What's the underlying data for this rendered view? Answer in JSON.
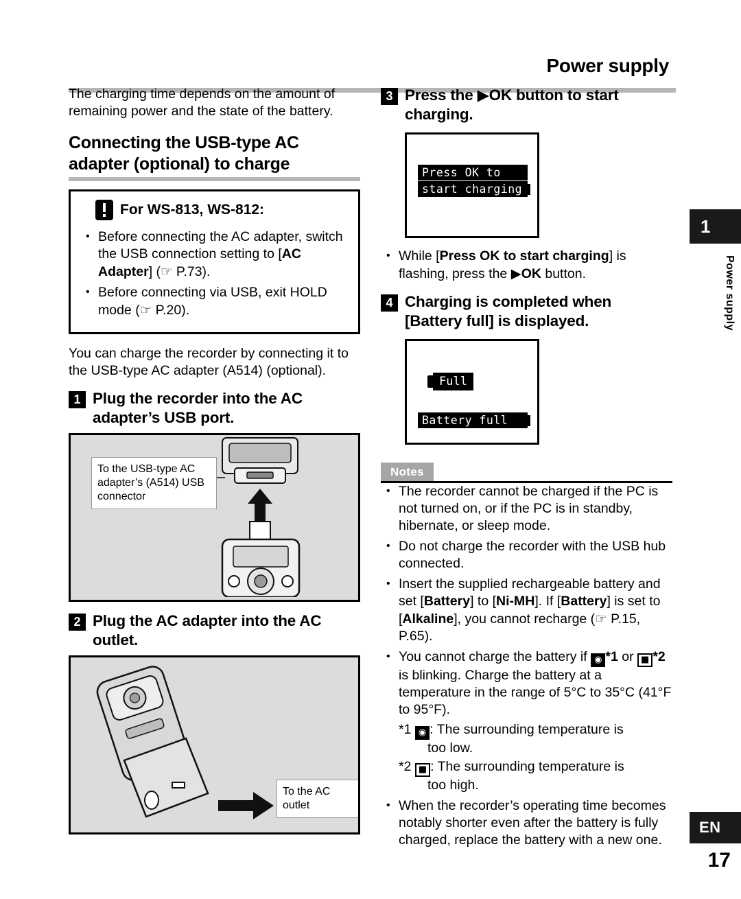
{
  "header": {
    "title": "Power supply"
  },
  "sidetab": {
    "chapter_number": "1",
    "chapter_label": "Power supply",
    "language": "EN",
    "page_number": "17"
  },
  "left": {
    "intro": "The charging time depends on the amount of remaining power and the state of the battery.",
    "section_heading": "Connecting the USB-type AC adapter (optional) to charge",
    "note_box": {
      "icon": "exclamation-icon",
      "title": "For WS-813, WS-812:",
      "bullets": [
        "Before connecting the AC adapter, switch the USB connection setting to [AC Adapter] (☞ P.73).",
        "Before connecting via USB, exit HOLD mode (☞ P.20)."
      ]
    },
    "paragraph": "You can charge the recorder by connecting it to the USB-type AC adapter (A514) (optional).",
    "step1": {
      "num": "1",
      "text": "Plug the recorder into the AC adapter’s USB port."
    },
    "figure1_callout": "To the USB-type AC adapter’s (A514) USB connector",
    "step2": {
      "num": "2",
      "text": "Plug the AC adapter into the AC outlet."
    },
    "figure2_callout": "To the AC outlet"
  },
  "right": {
    "step3": {
      "num": "3",
      "text": "Press the ▶OK button to start charging."
    },
    "lcd1": {
      "line1": "Press OK to",
      "line2": "start charging"
    },
    "step3_bullet": "While [Press OK to start charging] is flashing, press the ▶OK button.",
    "step4": {
      "num": "4",
      "text": "Charging is completed when [Battery full] is displayed."
    },
    "lcd2": {
      "icon": "battery-full-icon",
      "line1": "Full",
      "line2": "Battery full"
    },
    "notes_title": "Notes",
    "notes": [
      "The recorder cannot be charged if the PC is not turned on, or if the PC is in standby, hibernate, or sleep mode.",
      "Do not charge the recorder with the USB hub connected.",
      "Insert the supplied rechargeable battery and set [Battery] to [Ni-MH]. If [Battery] is set to [Alkaline], you cannot recharge (☞ P.15, P.65).",
      "You cannot charge the battery if [icon]*1 or [icon]*2 is blinking. Charge the battery at a temperature in the range of 5°C to 35°C (41°F to 95°F).",
      "When the recorder’s operating time becomes notably shorter even after the battery is fully charged, replace the battery with a new one."
    ],
    "footnote1": "*1 [icon]: The surrounding temperature is too low.",
    "footnote2": "*2 [icon]: The surrounding temperature is too high."
  }
}
